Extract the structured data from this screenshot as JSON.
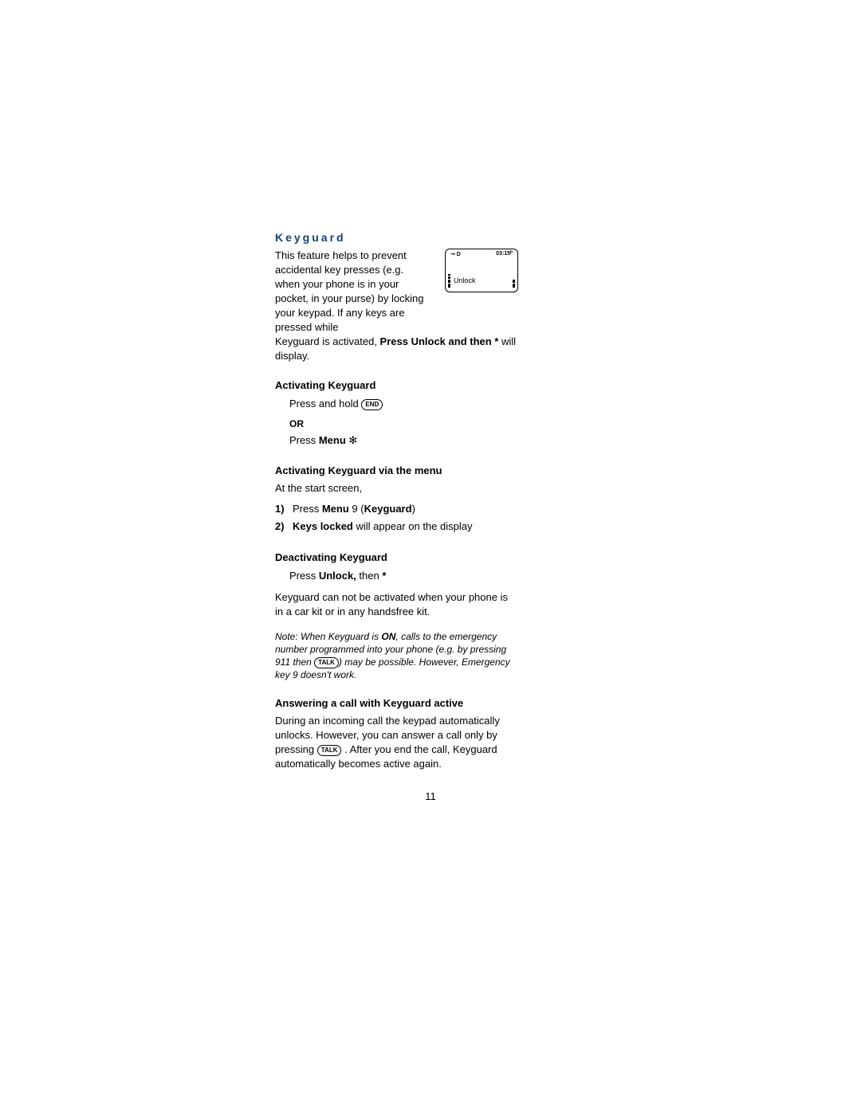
{
  "title": "Keyguard",
  "intro": {
    "part1": "This feature helps to prevent accidental key presses (e.g. when your phone is in your pocket, in your purse) by locking your keypad. If any keys are pressed while",
    "part2a": "Keyguard is activated, ",
    "part2b": "Press Unlock and then *",
    "part2c": " will display."
  },
  "screen": {
    "icon": "⊸ D",
    "time": "03:15ᴾ",
    "unlock": "Unlock"
  },
  "act": {
    "heading": "Activating Keyguard",
    "line1a": "Press and hold ",
    "key1": "END",
    "or": "OR",
    "line2a": "Press ",
    "line2b": "Menu",
    "line2c": " ✻"
  },
  "actmenu": {
    "heading": "Activating Keyguard via the menu",
    "intro": "At the start screen,",
    "s1_num": "1)",
    "s1a": "Press ",
    "s1b": "Menu",
    "s1c": " 9 (",
    "s1d": "Keyguard",
    "s1e": ")",
    "s2_num": "2)",
    "s2a": "Keys locked",
    "s2b": " will appear on the display"
  },
  "deact": {
    "heading": "Deactivating Keyguard",
    "line_a": "Press ",
    "line_b": "Unlock,",
    "line_c": " then ",
    "line_d": "*",
    "body": "Keyguard can not be activated when your phone is in a car kit or in any handsfree kit."
  },
  "note": {
    "a": "Note: When Keyguard is ",
    "b": "ON",
    "c": ", calls to the emergency number programmed into your phone (e.g. by pressing 911 then ",
    "key": "TALK",
    "d": ") may be possible. However, Emergency key 9 doesn't work."
  },
  "answer": {
    "heading": "Answering a call with Keyguard active",
    "a": "During an incoming call the keypad automatically unlocks. However, you can answer a call only by pressing ",
    "key": "TALK",
    "b": " . After you end the call, Keyguard automatically becomes active again."
  },
  "page_number": "11"
}
